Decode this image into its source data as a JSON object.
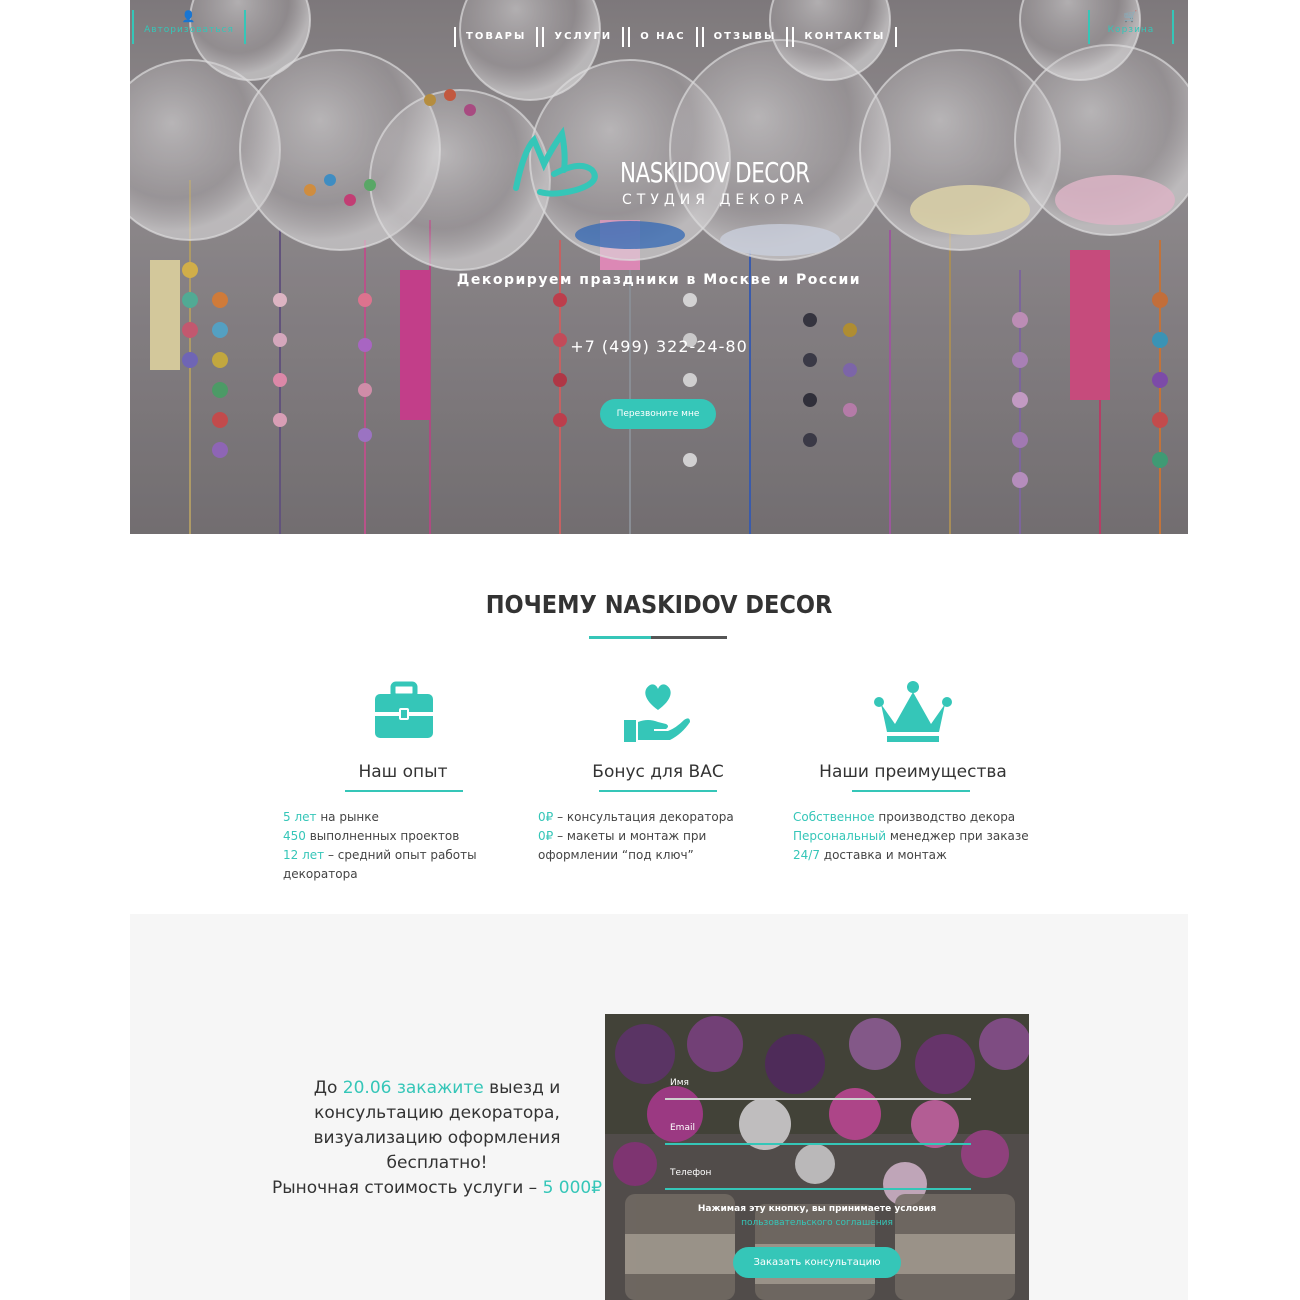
{
  "header": {
    "auth_label": "Авторизоваться",
    "cart_label": "Корзина",
    "nav": [
      "ТОВАРЫ",
      "УСЛУГИ",
      "О НАС",
      "ОТЗЫВЫ",
      "КОНТАКТЫ"
    ]
  },
  "hero": {
    "brand": "NASKIDOV DECOR",
    "brand_sub": "СТУДИЯ ДЕКОРА",
    "tagline": "Декорируем праздники в Москве и России",
    "phone": "+7 (499) 322-24-80",
    "call_button": "Перезвоните мне"
  },
  "why": {
    "title": "ПОЧЕМУ NASKIDOV DECOR",
    "columns": [
      {
        "icon": "briefcase-icon",
        "title": "Наш опыт",
        "lines": [
          {
            "hl": "5 лет",
            "text": " на рынке"
          },
          {
            "hl": "450",
            "text": " выполненных проектов"
          },
          {
            "hl": "12 лет",
            "text": " – средний опыт работы"
          },
          {
            "hl": "",
            "text": "декоратора"
          }
        ]
      },
      {
        "icon": "heart-hand-icon",
        "title": "Бонус для ВАС",
        "lines": [
          {
            "hl": "0₽",
            "text": " – консультация декоратора"
          },
          {
            "hl": "0₽",
            "text": " – макеты и монтаж при"
          },
          {
            "hl": "",
            "text": "оформлении “под ключ”"
          }
        ]
      },
      {
        "icon": "crown-icon",
        "title": "Наши преимущества",
        "lines": [
          {
            "hl": "Собственное",
            "text": " производство декора"
          },
          {
            "hl": "Персональный",
            "text": " менеджер при заказе"
          },
          {
            "hl": "24/7",
            "text": " доставка и монтаж"
          }
        ]
      }
    ]
  },
  "promo": {
    "line1_pre": "До ",
    "line1_hl": "20.06 закажите",
    "line1_post": " выезд и",
    "line2": "консультацию декоратора,",
    "line3": "визуализацию оформления",
    "line4": "бесплатно!",
    "line5_pre": "Рыночная стоимость услуги – ",
    "line5_hl": "5 000₽"
  },
  "form": {
    "name_label": "Имя",
    "email_label": "Email",
    "phone_label": "Телефон",
    "terms": "Нажимая эту кнопку, вы принимаете условия",
    "terms_link": "пользовательского соглашения",
    "submit": "Заказать консультацию"
  },
  "colors": {
    "accent": "#35c6b8",
    "text": "#333333",
    "promo_bg": "#f6f6f6"
  }
}
